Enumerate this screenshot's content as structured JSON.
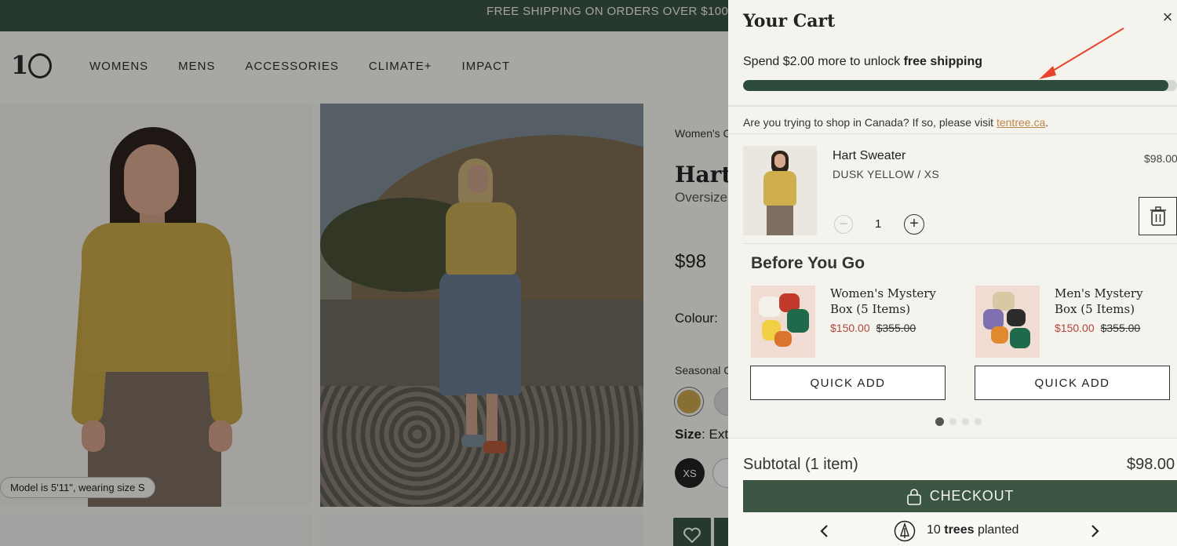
{
  "promo": {
    "text": "FREE SHIPPING ON ORDERS OVER $100"
  },
  "header": {
    "logo": "10",
    "nav": [
      "WOMENS",
      "MENS",
      "ACCESSORIES",
      "CLIMATE+",
      "IMPACT"
    ]
  },
  "gallery": {
    "model_note": "Model is 5'11\", wearing size S"
  },
  "product": {
    "breadcrumb": "Women's C",
    "title": "Hart S",
    "subtitle": "Oversize",
    "price": "$98",
    "colour_label": "Colour:",
    "seasonal_label": "Seasonal C",
    "size_label": "Size",
    "size_value": ": Ext",
    "size_selected": "XS"
  },
  "cart": {
    "title": "Your Cart",
    "close": "×",
    "shipping_prefix": "Spend $2.00 more to unlock ",
    "shipping_bold": "free shipping",
    "shipping_progress": 0.98,
    "canada_text": "Are you trying to shop in Canada? If so, please visit ",
    "canada_link": "tentree.ca",
    "canada_suffix": ".",
    "item": {
      "name": "Hart Sweater",
      "variant": "DUSK YELLOW / XS",
      "price": "$98.00",
      "quantity": "1",
      "minus": "−",
      "plus": "+"
    },
    "before_you_go": {
      "title": "Before You Go",
      "products": [
        {
          "name": "Women's Mystery Box (5 Items)",
          "sale_price": "$150.00",
          "original_price": "$355.00",
          "button": "QUICK ADD"
        },
        {
          "name": "Men's Mystery Box (5 Items)",
          "sale_price": "$150.00",
          "original_price": "$355.00",
          "button": "QUICK ADD"
        }
      ],
      "pages": 4,
      "active_page": 1
    },
    "subtotal_label": "Subtotal (1 item)",
    "subtotal_value": "$98.00",
    "checkout": "CHECKOUT",
    "trees_count": "10",
    "trees_bold": "trees",
    "trees_suffix": "planted"
  },
  "colors": {
    "brand_green": "#3a5542",
    "progress_green": "#2e4c3b",
    "sale_red": "#b5453a",
    "link_orange": "#c0884a",
    "annotation_arrow": "#e8452c"
  }
}
